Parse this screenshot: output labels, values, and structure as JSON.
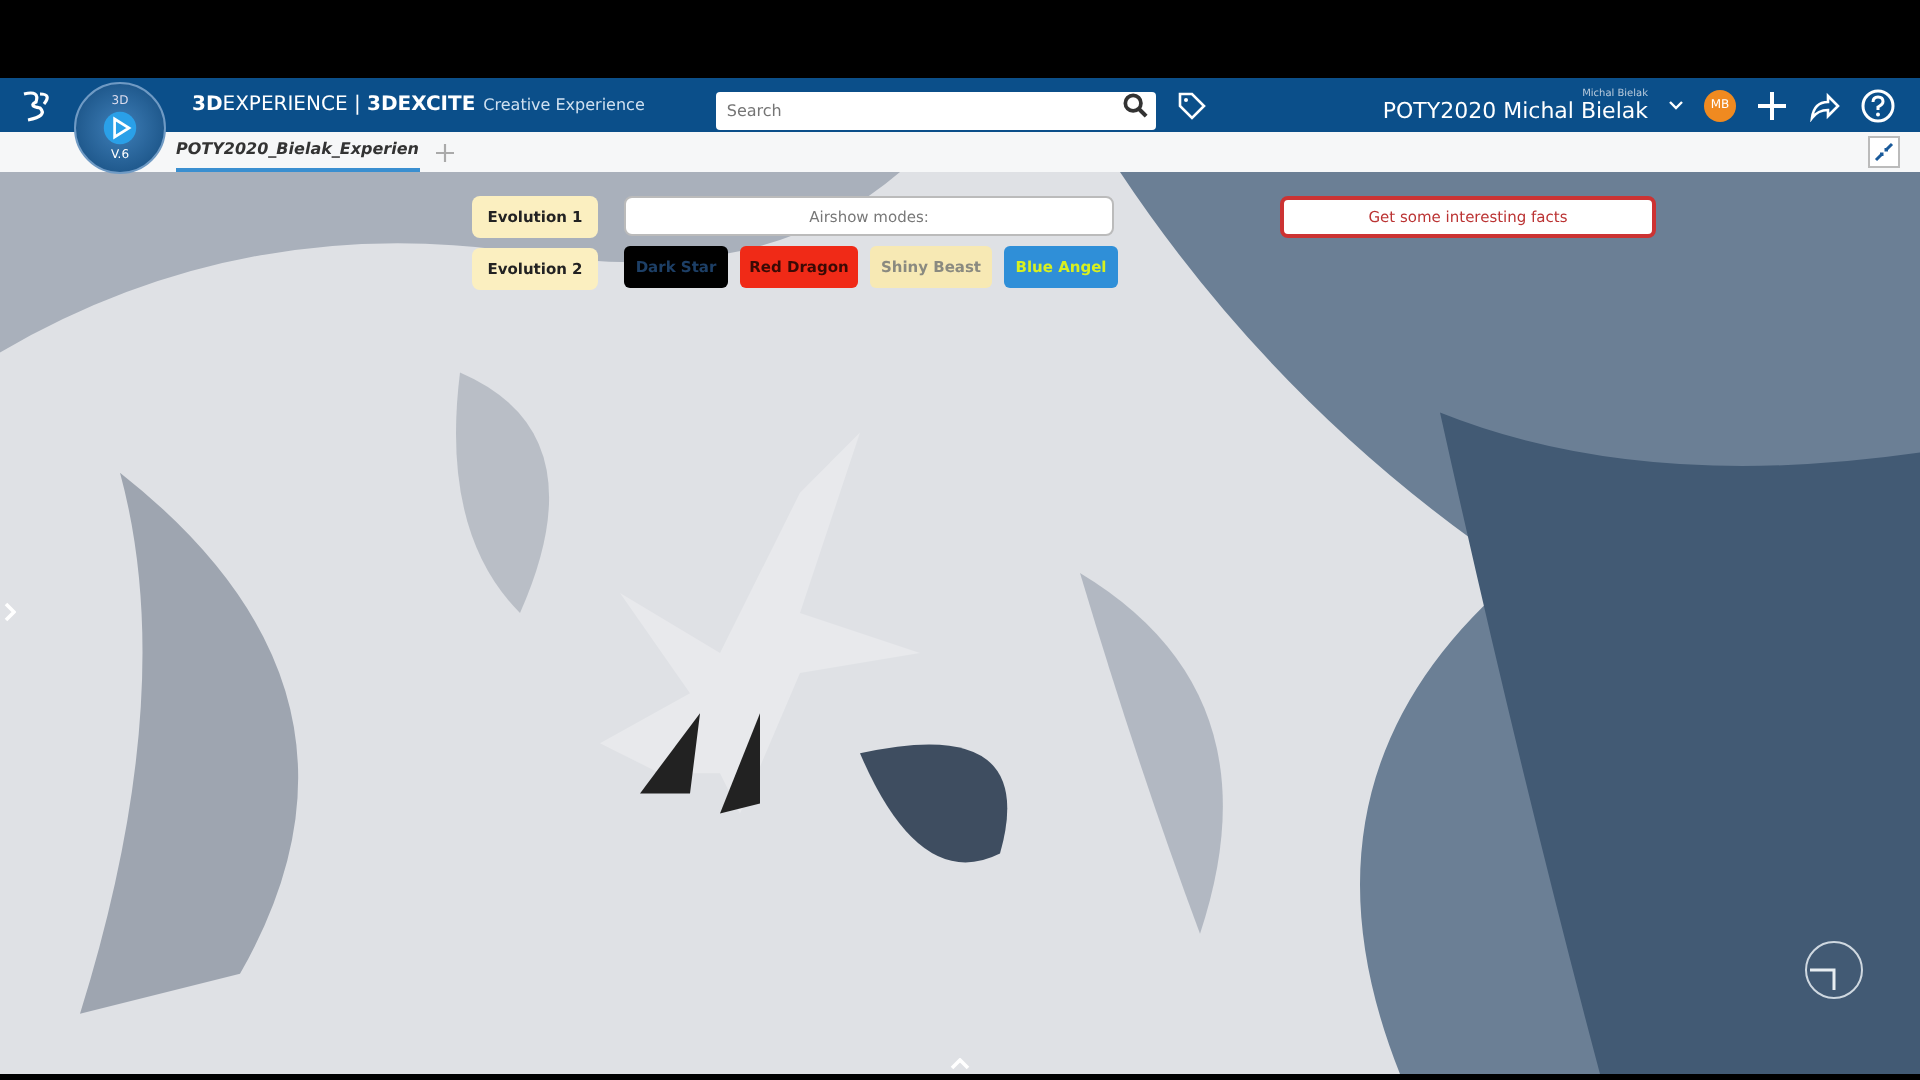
{
  "header": {
    "brand_bold": "3D",
    "brand": "EXPERIENCE",
    "separator": "|",
    "app": "3DEXCITE",
    "app_suffix": "Creative Experience",
    "compass": {
      "top": "3D",
      "bottom": "V.6"
    },
    "search": {
      "placeholder": "Search"
    },
    "user_small": "Michal Bielak",
    "user": "POTY2020 Michal Bielak",
    "avatar": "MB"
  },
  "tabs": [
    {
      "label": "POTY2020_Bielak_Experien",
      "selected": true
    }
  ],
  "scene": {
    "kind": "picture",
    "evolutions": [
      {
        "label": "Evolution 1"
      },
      {
        "label": "Evolution 2"
      }
    ],
    "modes_title": "Airshow modes:",
    "modes": [
      {
        "label": "Dark Star",
        "color": "#000000"
      },
      {
        "label": "Red Dragon",
        "color": "#f02a17"
      },
      {
        "label": "Shiny Beast",
        "color": "#f7e9b4"
      },
      {
        "label": "Blue Angel",
        "color": "#2f8fd8"
      }
    ],
    "facts": "Get some interesting facts"
  }
}
